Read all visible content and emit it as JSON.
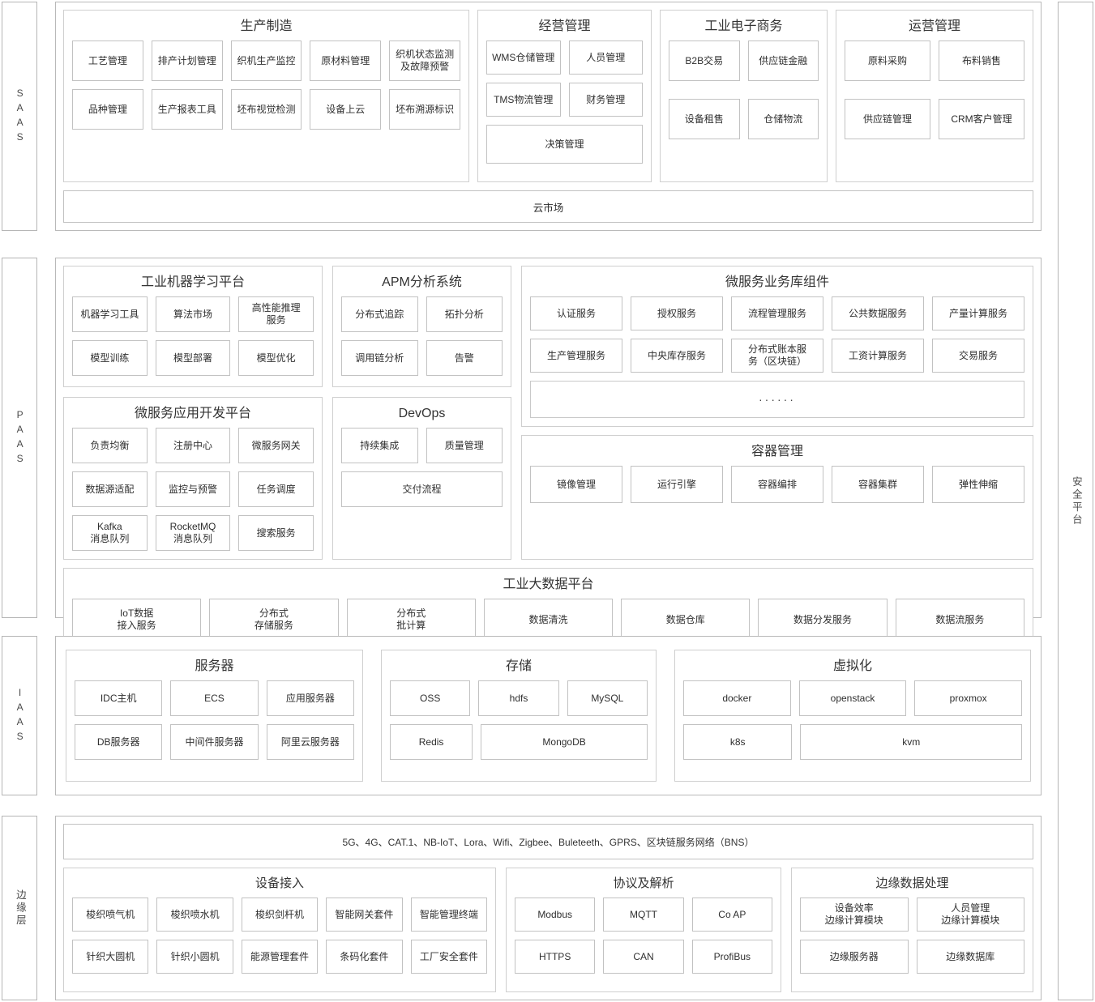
{
  "layers": {
    "saas": {
      "tag": "SAAS",
      "groups": [
        {
          "title": "生产制造",
          "rows": [
            [
              "工艺管理",
              "排产计划管理",
              "织机生产监控",
              "原材料管理",
              "织机状态监测\n及故障预警"
            ],
            [
              "品种管理",
              "生产报表工具",
              "坯布视觉检测",
              "设备上云",
              "坯布溯源标识"
            ]
          ]
        },
        {
          "title": "经营管理",
          "rows": [
            [
              "WMS仓储管理",
              "人员管理"
            ],
            [
              "TMS物流管理",
              "财务管理"
            ],
            [
              "决策管理"
            ]
          ]
        },
        {
          "title": "工业电子商务",
          "rows": [
            [
              "B2B交易",
              "供应链金融"
            ],
            [
              "设备租售",
              "仓储物流"
            ]
          ]
        },
        {
          "title": "运营管理",
          "rows": [
            [
              "原料采购",
              "布料销售"
            ],
            [
              "供应链管理",
              "CRM客户管理"
            ]
          ]
        }
      ],
      "cloud_market": "云市场"
    },
    "paas": {
      "tag": "PAAS",
      "groups": [
        {
          "title": "工业机器学习平台",
          "rows": [
            [
              "机器学习工具",
              "算法市场",
              "高性能推理\n服务"
            ],
            [
              "模型训练",
              "模型部署",
              "模型优化"
            ]
          ]
        },
        {
          "title": "微服务应用开发平台",
          "rows": [
            [
              "负责均衡",
              "注册中心",
              "微服务网关"
            ],
            [
              "数据源适配",
              "监控与预警",
              "任务调度"
            ],
            [
              "Kafka\n消息队列",
              "RocketMQ\n消息队列",
              "搜索服务"
            ]
          ]
        },
        {
          "title": "APM分析系统",
          "rows": [
            [
              "分布式追踪",
              "拓扑分析"
            ],
            [
              "调用链分析",
              "告警"
            ]
          ]
        },
        {
          "title": "DevOps",
          "rows": [
            [
              "持续集成",
              "质量管理"
            ],
            [
              "交付流程"
            ]
          ]
        },
        {
          "title": "微服务业务库组件",
          "rows": [
            [
              "认证服务",
              "授权服务",
              "流程管理服务",
              "公共数据服务",
              "产量计算服务"
            ],
            [
              "生产管理服务",
              "中央库存服务",
              "分布式账本服\n务（区块链）",
              "工资计算服务",
              "交易服务"
            ]
          ],
          "ellipsis": "······"
        },
        {
          "title": "容器管理",
          "rows": [
            [
              "镜像管理",
              "运行引擎",
              "容器编排",
              "容器集群",
              "弹性伸缩"
            ]
          ]
        },
        {
          "title": "工业大数据平台",
          "rows": [
            [
              "IoT数据\n接入服务",
              "分布式\n存储服务",
              "分布式\n批计算",
              "数据清洗",
              "数据仓库",
              "数据分发服务",
              "数据流服务"
            ]
          ]
        }
      ]
    },
    "iaas": {
      "tag": "IAAS",
      "groups": [
        {
          "title": "服务器",
          "rows": [
            [
              "IDC主机",
              "ECS",
              "应用服务器"
            ],
            [
              "DB服务器",
              "中间件服务器",
              "阿里云服务器"
            ]
          ]
        },
        {
          "title": "存储",
          "rows": [
            [
              "OSS",
              "hdfs",
              "MySQL"
            ],
            [
              "Redis",
              "MongoDB"
            ]
          ]
        },
        {
          "title": "虚拟化",
          "rows": [
            [
              "docker",
              "openstack",
              "proxmox"
            ],
            [
              "k8s",
              "kvm"
            ]
          ]
        }
      ]
    },
    "edge": {
      "tag": "边缘层",
      "network_bar": "5G、4G、CAT.1、NB-IoT、Lora、Wifi、Zigbee、Buleteeth、GPRS、区块链服务网络（BNS）",
      "groups": [
        {
          "title": "设备接入",
          "rows": [
            [
              "梭织喷气机",
              "梭织喷水机",
              "梭织剑杆机",
              "智能网关套件",
              "智能管理终端"
            ],
            [
              "针织大圆机",
              "针织小圆机",
              "能源管理套件",
              "条码化套件",
              "工厂安全套件"
            ]
          ]
        },
        {
          "title": "协议及解析",
          "rows": [
            [
              "Modbus",
              "MQTT",
              "Co AP"
            ],
            [
              "HTTPS",
              "CAN",
              "ProfiBus"
            ]
          ]
        },
        {
          "title": "边缘数据处理",
          "rows": [
            [
              "设备效率\n边缘计算模块",
              "人员管理\n边缘计算模块"
            ],
            [
              "边缘服务器",
              "边缘数据库"
            ]
          ]
        }
      ]
    }
  },
  "security_column": {
    "label": "安全平台"
  },
  "colors": {
    "border_outer": "#b9b9b9",
    "border_group": "#cfcfcf",
    "border_cell": "#c2c2c2",
    "text": "#2f2f2f",
    "background": "#ffffff"
  }
}
